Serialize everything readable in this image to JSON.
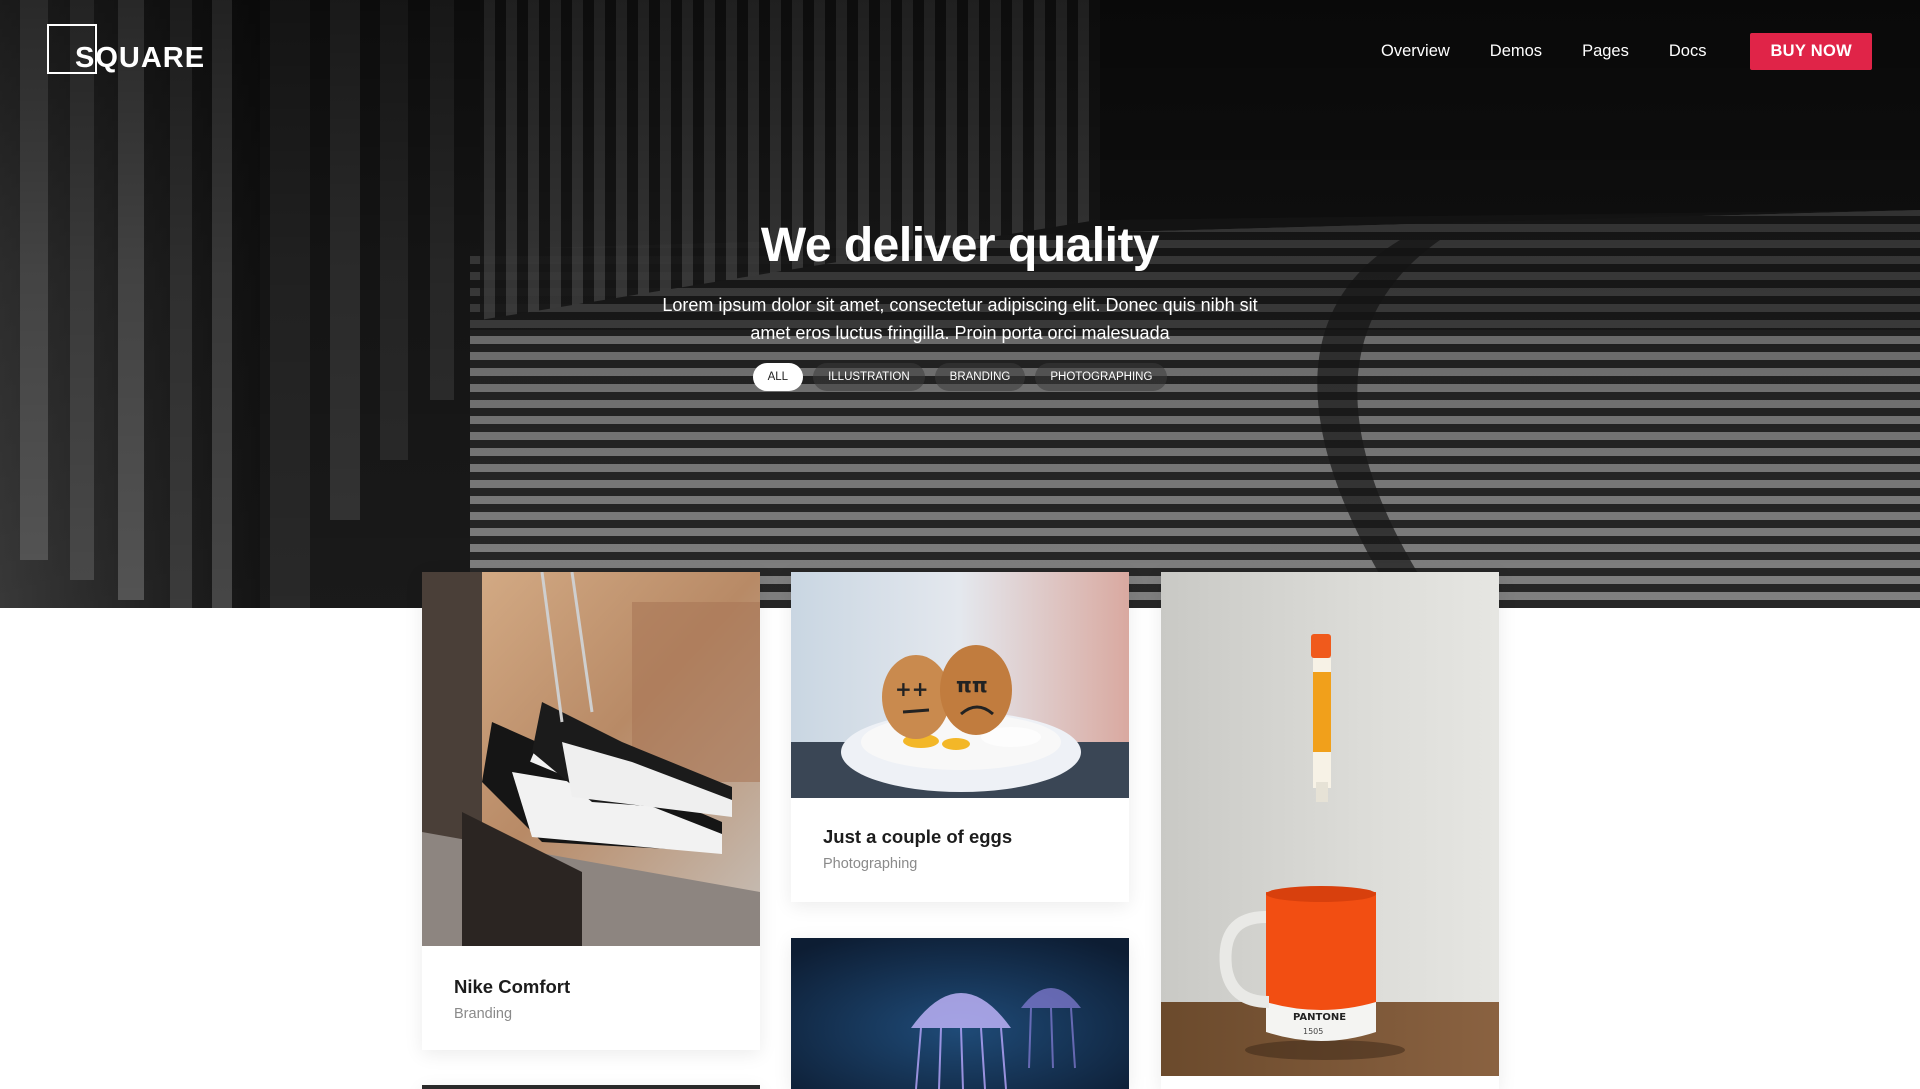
{
  "brand": {
    "logo_text": "SQUARE"
  },
  "nav": {
    "items": [
      "Overview",
      "Demos",
      "Pages",
      "Docs"
    ],
    "cta": "BUY NOW",
    "cta_color": "#e02448"
  },
  "hero": {
    "title": "We deliver quality",
    "subtitle": "Lorem ipsum dolor sit amet, consectetur adipiscing elit. Donec quis nibh sit amet eros luctus fringilla. Proin porta orci malesuada",
    "filters": [
      "ALL",
      "ILLUSTRATION",
      "BRANDING",
      "PHOTOGRAPHING"
    ],
    "active_filter": "ALL"
  },
  "portfolio": [
    {
      "title": "Nike Comfort",
      "category": "Branding",
      "image": "sneakers-photo"
    },
    {
      "title": "Just a couple of eggs",
      "category": "Photographing",
      "image": "eggs-photo"
    },
    {
      "title": "",
      "category": "",
      "image": "jellyfish-photo"
    },
    {
      "title": "",
      "category": "",
      "image": "marker-and-mug-photo"
    }
  ]
}
